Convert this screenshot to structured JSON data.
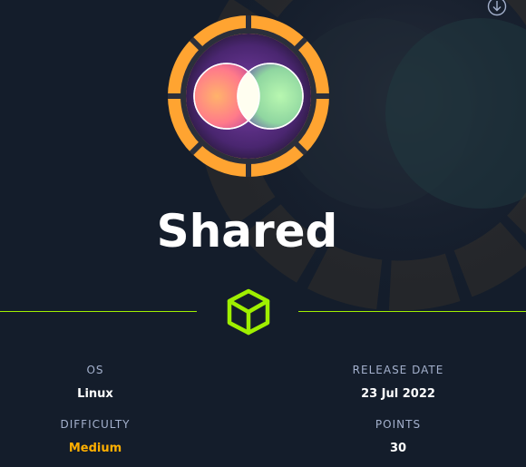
{
  "machine": {
    "name": "Shared",
    "stats": [
      {
        "label": "OS",
        "value": "Linux"
      },
      {
        "label": "RELEASE DATE",
        "value": "23 Jul 2022"
      },
      {
        "label": "DIFFICULTY",
        "value": "Medium"
      },
      {
        "label": "POINTS",
        "value": "30"
      }
    ]
  },
  "icons": {
    "download": "download-circle-icon",
    "logo": "machine-logo-icon",
    "divider": "cube-icon"
  },
  "colors": {
    "background": "#141d2b",
    "accent_green": "#9fef00",
    "medium_orange": "#ffaf00",
    "ring_orange": "#ffa431",
    "label_gray": "#a4b1cd",
    "text_white": "#ffffff"
  }
}
